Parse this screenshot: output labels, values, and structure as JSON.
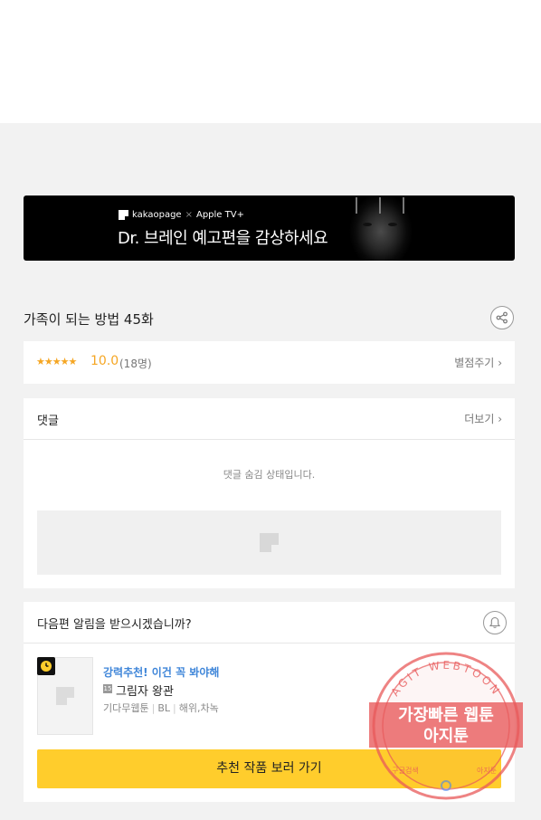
{
  "banner": {
    "brand": "kakaopage",
    "times": "×",
    "partner": "Apple TV+",
    "headline": "Dr. 브레인 예고편을 감상하세요"
  },
  "episode": {
    "title": "가족이 되는 방법 45화"
  },
  "rating": {
    "stars": "★★★★★",
    "score": "10.0",
    "count": "(18명)",
    "rate_label": "별점주기"
  },
  "comments": {
    "title": "댓글",
    "more_label": "더보기",
    "hidden_message": "댓글 숨김 상태입니다."
  },
  "notify": {
    "question": "다음편 알림을 받으시겠습니까?",
    "recommend_label": "강력추천! 이건 꼭 봐야해",
    "age_badge": "15",
    "work_title": "그림자 왕관",
    "meta": [
      "기다무웹툰",
      "BL",
      "해위,차녹"
    ],
    "cta_label": "추천 작품 보러 가기"
  },
  "watermark": {
    "arc_text": "AGIT WEBTOON",
    "line1": "가장빠른 웹툰",
    "line2": "아지툰",
    "small_left": "구글검색",
    "small_right": "아지툰"
  },
  "colors": {
    "accent_yellow": "#ffcd2c",
    "star_orange": "#f5a623",
    "link_blue": "#3f86d9",
    "watermark_red": "#e8595a"
  }
}
